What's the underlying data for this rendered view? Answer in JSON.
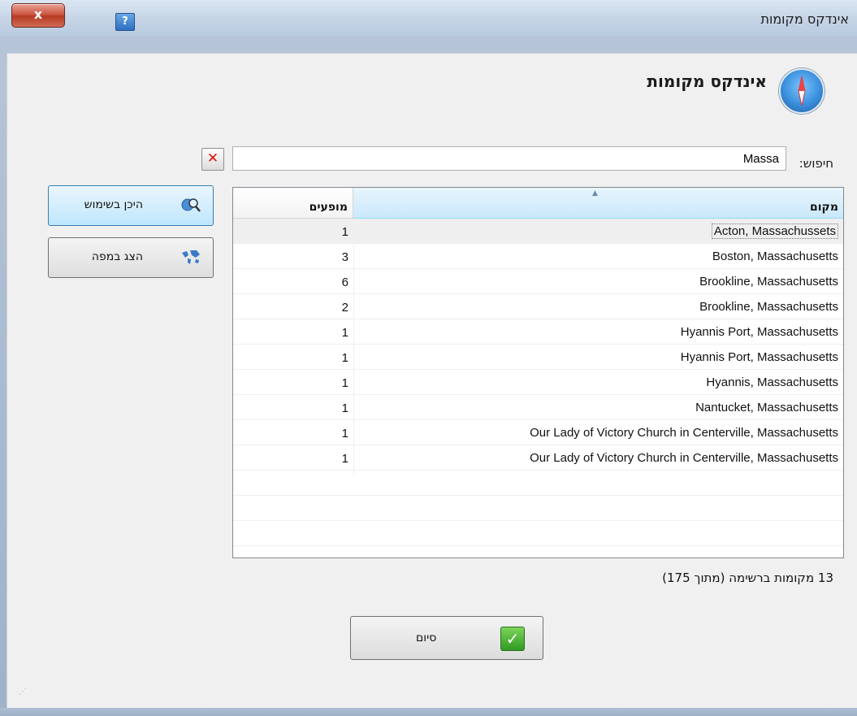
{
  "window": {
    "title": "אינדקס מקומות",
    "close_label": "x",
    "help_label": "?"
  },
  "header": {
    "heading": "אינדקס מקומות",
    "icon": "compass-icon"
  },
  "search": {
    "label": "חיפוש:",
    "value": "Massa",
    "clear_icon": "clear-x-icon"
  },
  "sidebar": {
    "where_used": {
      "label": "היכן בשימוש",
      "icon": "magnifier-icon"
    },
    "show_map": {
      "label": "הצג במפה",
      "icon": "world-map-icon"
    }
  },
  "table": {
    "headers": {
      "count": "מופעים",
      "place": "מקום"
    },
    "rows": [
      {
        "count": "1",
        "place": "Acton, Massachussets"
      },
      {
        "count": "3",
        "place": "Boston, Massachusetts"
      },
      {
        "count": "6",
        "place": "Brookline, Massachusetts"
      },
      {
        "count": "2",
        "place": "Brookline, Massachusetts"
      },
      {
        "count": "1",
        "place": "Hyannis Port, Massachusetts"
      },
      {
        "count": "1",
        "place": "Hyannis Port, Massachusetts"
      },
      {
        "count": "1",
        "place": "Hyannis, Massachusetts"
      },
      {
        "count": "1",
        "place": "Nantucket, Massachusetts"
      },
      {
        "count": "1",
        "place": "Our Lady of Victory Church in Centerville, Massachusetts"
      },
      {
        "count": "1",
        "place": "Our Lady of Victory Church in Centerville, Massachusetts"
      }
    ]
  },
  "status": {
    "text": "13 מקומות ברשימה (מתוך 175)"
  },
  "footer": {
    "done_label": "סיום",
    "done_icon": "checkmark-icon"
  }
}
